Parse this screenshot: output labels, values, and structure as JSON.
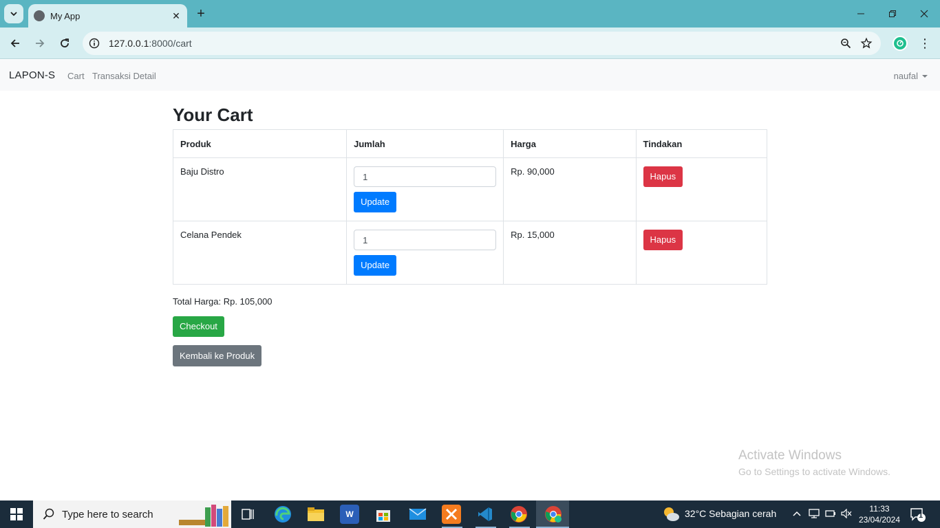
{
  "browser": {
    "tab_title": "My App",
    "url_host": "127.0.0.1",
    "url_rest": ":8000/cart"
  },
  "navbar": {
    "brand": "LAPON-S",
    "links": [
      "Cart",
      "Transaksi Detail"
    ],
    "user": "naufal"
  },
  "cart": {
    "title": "Your Cart",
    "headers": [
      "Produk",
      "Jumlah",
      "Harga",
      "Tindakan"
    ],
    "rows": [
      {
        "product": "Baju Distro",
        "qty": "1",
        "price": "Rp. 90,000",
        "update_label": "Update",
        "delete_label": "Hapus"
      },
      {
        "product": "Celana Pendek",
        "qty": "1",
        "price": "Rp. 15,000",
        "update_label": "Update",
        "delete_label": "Hapus"
      }
    ],
    "total": "Total Harga: Rp. 105,000",
    "checkout_label": "Checkout",
    "back_label": "Kembali ke Produk"
  },
  "watermark": {
    "title": "Activate Windows",
    "subtitle": "Go to Settings to activate Windows."
  },
  "taskbar": {
    "search_placeholder": "Type here to search",
    "weather": "32°C  Sebagian cerah",
    "time": "11:33",
    "date": "23/04/2024",
    "notification_count": "1"
  },
  "colors": {
    "primary": "#007bff",
    "danger": "#dc3545",
    "success": "#28a745",
    "secondary": "#6c757d",
    "browser_frame": "#5ab5c2"
  }
}
